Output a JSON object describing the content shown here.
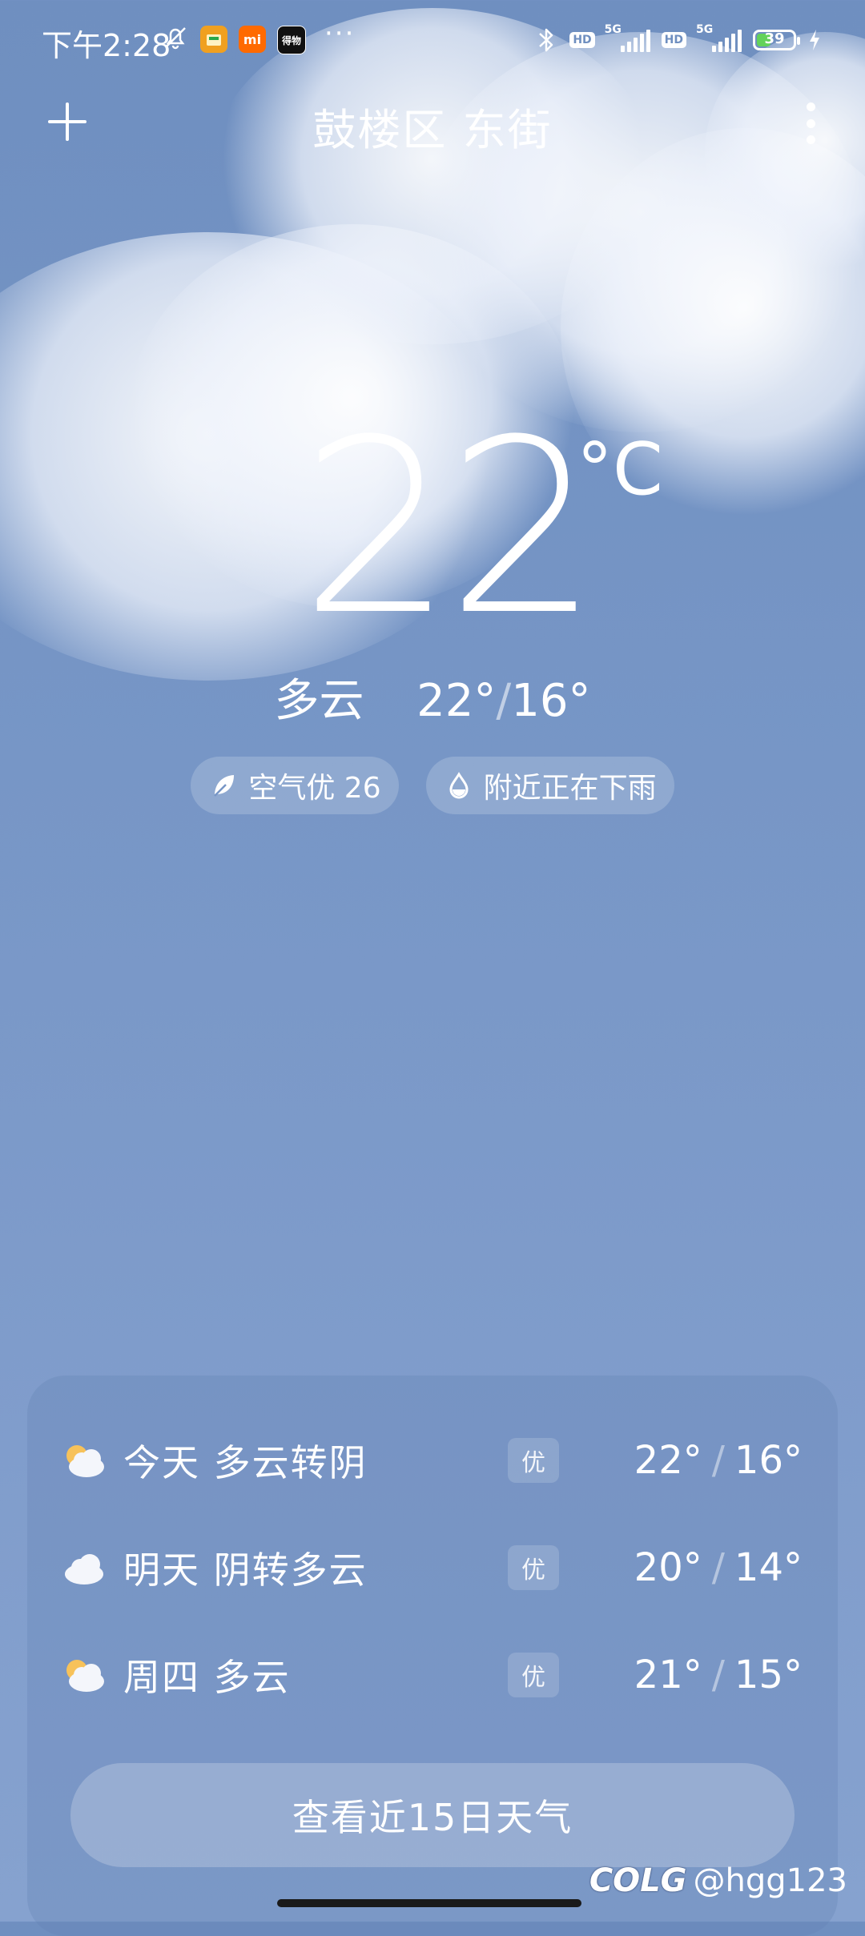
{
  "status_bar": {
    "time": "下午2:28",
    "app_icons": [
      "bell-muted-icon",
      "app-icon-1",
      "mi-app-icon",
      "dewu-app-icon"
    ],
    "mi_label": "mi",
    "dewu_label": "得物",
    "more": "···",
    "network": [
      "HD",
      "5G",
      "HD",
      "5G"
    ],
    "battery_percent": "39",
    "battery_level": 0.39,
    "charging": true
  },
  "header": {
    "location": "鼓楼区 东街"
  },
  "current": {
    "temperature": "22",
    "unit": "°C",
    "condition": "多云",
    "high": "22°",
    "sep": "/",
    "low": "16°"
  },
  "pills": {
    "air_quality": "空气优 26",
    "rain": "附近正在下雨"
  },
  "forecast": [
    {
      "day_desc": "今天  多云转阴",
      "aq": "优",
      "high": "22°",
      "low": "16°",
      "icon": "partly-cloudy-icon"
    },
    {
      "day_desc": "明天  阴转多云",
      "aq": "优",
      "high": "20°",
      "low": "14°",
      "icon": "cloudy-icon"
    },
    {
      "day_desc": "周四  多云",
      "aq": "优",
      "high": "21°",
      "low": "15°",
      "icon": "partly-cloudy-icon"
    }
  ],
  "forecast_sep": "/",
  "cta": "查看近15日天气",
  "watermark": {
    "brand": "COLG",
    "user": "@hgg123"
  },
  "colors": {
    "background": "#7796c6",
    "battery_fill": "#63d25a",
    "sun": "#f7c25a"
  }
}
